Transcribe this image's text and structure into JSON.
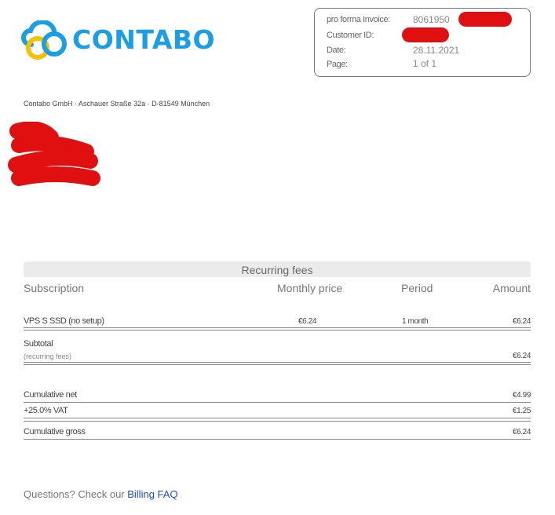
{
  "brand": {
    "name": "CONTABO",
    "colors": {
      "blue": "#1c9ee6",
      "yellow": "#f5c100",
      "redaction": "#e01010"
    }
  },
  "info": {
    "invoice_label": "pro forma Invoice:",
    "invoice_value": "8061950",
    "customer_label": "Customer ID:",
    "date_label": "Date:",
    "date_value": "28.11.2021",
    "page_label": "Page:",
    "page_value": "1 of 1"
  },
  "sender_line": "Contabo GmbH · Aschauer Straße 32a · D-81549 München",
  "table": {
    "section_title": "Recurring fees",
    "headers": {
      "subscription": "Subscription",
      "monthly_price": "Monthly price",
      "period": "Period",
      "amount": "Amount"
    },
    "rows": [
      {
        "subscription": "VPS S SSD (no setup)",
        "monthly_price": "€6.24",
        "period": "1 month",
        "amount": "€6.24"
      }
    ],
    "subtotal": {
      "label": "Subtotal",
      "sublabel": "(recurring fees)",
      "amount": "€6.24"
    },
    "cumulative_net": {
      "label": "Cumulative net",
      "amount": "€4.99"
    },
    "vat": {
      "label": "+25.0% VAT",
      "amount": "€1.25"
    },
    "cumulative_gross": {
      "label": "Cumulative gross",
      "amount": "€6.24"
    }
  },
  "footer": {
    "questions_text": "Questions? Check our ",
    "link_text": "Billing FAQ"
  }
}
